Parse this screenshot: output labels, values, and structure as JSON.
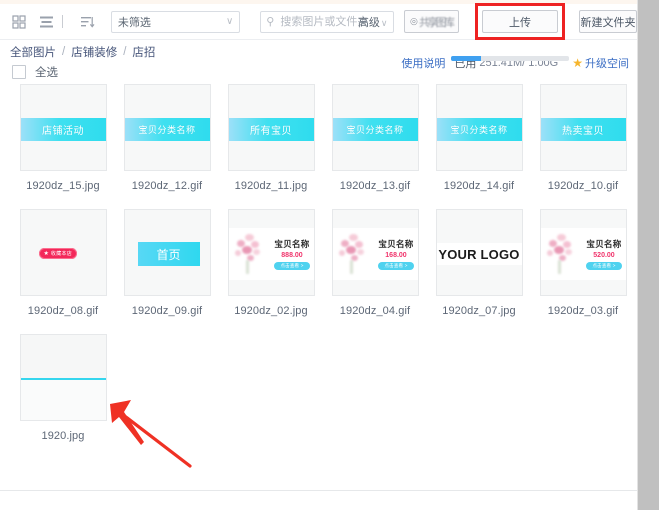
{
  "toolbar": {
    "icons": [
      {
        "name": "grid-view-icon",
        "label": "grid-view"
      },
      {
        "name": "list-view-icon",
        "label": "list-view"
      },
      {
        "name": "sort-icon",
        "label": "sort"
      }
    ],
    "filter": {
      "value": "未筛选",
      "caret": "∨"
    },
    "search": {
      "placeholder": "搜索图片或文件夹",
      "value": "",
      "icon": "search-icon",
      "advanced_label": "高级",
      "advanced_caret": "∨"
    },
    "gallery_button": {
      "label": "共享图库",
      "icon": "◎"
    },
    "upload_button": {
      "label": "上传",
      "highlight_color": "#ee2222"
    },
    "new_folder_button": {
      "label": "新建文件夹"
    }
  },
  "breadcrumb": {
    "items": [
      "全部图片",
      "店铺装修",
      "店招"
    ],
    "separator": "/"
  },
  "storage": {
    "usage_help": "使用说明",
    "used_label": "已用",
    "used_value": "251.41M/ 1.00G",
    "upgrade_label": "升级空间",
    "star_icon": "★",
    "percent": 25,
    "bar_color": "#3fa0f0"
  },
  "select_all": {
    "label": "全选",
    "checked": false
  },
  "files": [
    {
      "filename": "1920dz_15.jpg",
      "kind": "banner",
      "text": "店铺活动"
    },
    {
      "filename": "1920dz_12.gif",
      "kind": "banner",
      "text": "宝贝分类名称"
    },
    {
      "filename": "1920dz_11.jpg",
      "kind": "banner",
      "text": "所有宝贝"
    },
    {
      "filename": "1920dz_13.gif",
      "kind": "banner",
      "text": "宝贝分类名称"
    },
    {
      "filename": "1920dz_14.gif",
      "kind": "banner",
      "text": "宝贝分类名称"
    },
    {
      "filename": "1920dz_10.gif",
      "kind": "banner",
      "text": "热卖宝贝"
    },
    {
      "filename": "1920dz_08.gif",
      "kind": "pill",
      "text": "收藏本店"
    },
    {
      "filename": "1920dz_09.gif",
      "kind": "button",
      "text": "首页"
    },
    {
      "filename": "1920dz_02.jpg",
      "kind": "product",
      "text": "宝贝名称",
      "price": "888.00",
      "cta": "点击查看 >"
    },
    {
      "filename": "1920dz_04.gif",
      "kind": "product",
      "text": "宝贝名称",
      "price": "168.00",
      "cta": "点击查看 >"
    },
    {
      "filename": "1920dz_07.jpg",
      "kind": "logo",
      "text": "YOUR LOGO"
    },
    {
      "filename": "1920dz_03.gif",
      "kind": "product",
      "text": "宝贝名称",
      "price": "520.00",
      "cta": "点击查看 >"
    },
    {
      "filename": "1920.jpg",
      "kind": "line",
      "text": ""
    }
  ],
  "annotation": {
    "arrow_color": "#ef3124",
    "points_to": "1920.jpg"
  }
}
